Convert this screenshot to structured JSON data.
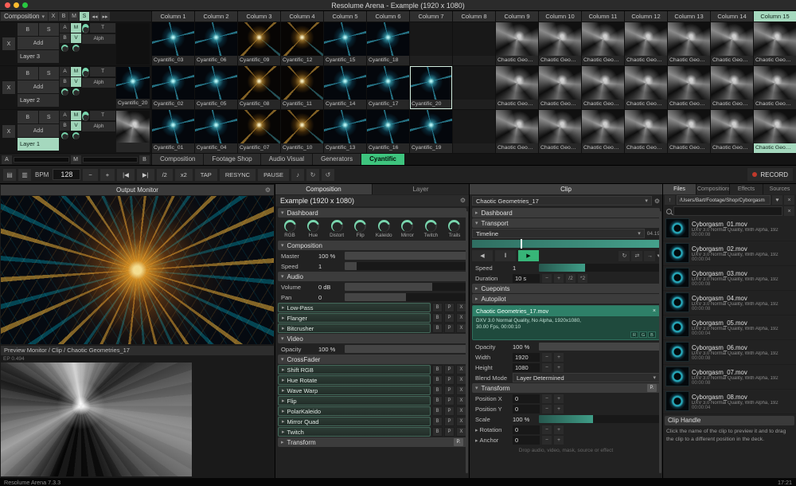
{
  "titlebar": {
    "title": "Resolume Arena - Example (1920 x 1080)"
  },
  "grid": {
    "composition_menu": "Composition",
    "comp_buttons": [
      "X",
      "B",
      "M",
      "S"
    ],
    "columns": [
      "Column 1",
      "Column 2",
      "Column 3",
      "Column 4",
      "Column 5",
      "Column 6",
      "Column 7",
      "Column 8",
      "Column 9",
      "Column 10",
      "Column 11",
      "Column 12",
      "Column 13",
      "Column 14",
      "Column 15"
    ],
    "active_column": "Column 15",
    "layers": [
      {
        "name": "Layer 3",
        "clear": "X",
        "bypass": "B",
        "solo": "S",
        "add": "Add",
        "ab": [
          "A",
          "B"
        ],
        "mv": [
          "M",
          "V"
        ],
        "t": "T",
        "alpha": "Alph",
        "preview": null,
        "clips": [
          {
            "label": "Cyantific_03",
            "variant": "teal"
          },
          {
            "label": "Cyantific_06",
            "variant": "teal"
          },
          {
            "label": "Cyantific_09",
            "variant": "gold"
          },
          {
            "label": "Cyantific_12",
            "variant": "gold"
          },
          {
            "label": "Cyantific_15",
            "variant": "teal"
          },
          {
            "label": "Cyantific_18",
            "variant": "teal"
          },
          {
            "label": "",
            "variant": "empty"
          },
          {
            "label": "",
            "variant": "empty"
          },
          {
            "label": "Chaotic Geometri...",
            "variant": "gray"
          },
          {
            "label": "Chaotic Geometri...",
            "variant": "gray"
          },
          {
            "label": "Chaotic Geometri...",
            "variant": "gray"
          },
          {
            "label": "Chaotic Geometri...",
            "variant": "gray"
          },
          {
            "label": "Chaotic Geometri...",
            "variant": "gray"
          },
          {
            "label": "Chaotic Geometri...",
            "variant": "gray"
          },
          {
            "label": "Chaotic Geometri...",
            "variant": "gray"
          }
        ]
      },
      {
        "name": "Layer 2",
        "clear": "X",
        "bypass": "B",
        "solo": "S",
        "add": "Add",
        "ab": [
          "A",
          "B"
        ],
        "mv": [
          "M",
          "V"
        ],
        "t": "T",
        "alpha": "Alph",
        "preview": {
          "label": "Cyantific_20",
          "variant": "teal"
        },
        "clips": [
          {
            "label": "Cyantific_02",
            "variant": "teal"
          },
          {
            "label": "Cyantific_05",
            "variant": "teal"
          },
          {
            "label": "Cyantific_08",
            "variant": "gold"
          },
          {
            "label": "Cyantific_11",
            "variant": "gold"
          },
          {
            "label": "Cyantific_14",
            "variant": "teal"
          },
          {
            "label": "Cyantific_17",
            "variant": "teal"
          },
          {
            "label": "Cyantific_20",
            "variant": "teal",
            "selected": true
          },
          {
            "label": "",
            "variant": "empty"
          },
          {
            "label": "Chaotic Geometri...",
            "variant": "gray"
          },
          {
            "label": "Chaotic Geometri...",
            "variant": "gray"
          },
          {
            "label": "Chaotic Geometri...",
            "variant": "gray"
          },
          {
            "label": "Chaotic Geometri...",
            "variant": "gray"
          },
          {
            "label": "Chaotic Geometri...",
            "variant": "gray"
          },
          {
            "label": "Chaotic Geometri...",
            "variant": "gray"
          },
          {
            "label": "Chaotic Geometri...",
            "variant": "gray"
          }
        ]
      },
      {
        "name": "Layer 1",
        "active": true,
        "clear": "X",
        "bypass": "B",
        "solo": "S",
        "add": "Add",
        "ab": [
          "A",
          "B"
        ],
        "mv": [
          "M",
          "V"
        ],
        "t": "T",
        "alpha": "Alph",
        "preview": {
          "label": "",
          "variant": "gray"
        },
        "clips": [
          {
            "label": "Cyantific_01",
            "variant": "teal"
          },
          {
            "label": "Cyantific_04",
            "variant": "teal"
          },
          {
            "label": "Cyantific_07",
            "variant": "gold"
          },
          {
            "label": "Cyantific_10",
            "variant": "gold"
          },
          {
            "label": "Cyantific_13",
            "variant": "teal"
          },
          {
            "label": "Cyantific_16",
            "variant": "teal"
          },
          {
            "label": "Cyantific_19",
            "variant": "teal"
          },
          {
            "label": "",
            "variant": "empty"
          },
          {
            "label": "Chaotic Geometri...",
            "variant": "gray"
          },
          {
            "label": "Chaotic Geometri...",
            "variant": "gray"
          },
          {
            "label": "Chaotic Geometri...",
            "variant": "gray"
          },
          {
            "label": "Chaotic Geometri...",
            "variant": "gray"
          },
          {
            "label": "Chaotic Geometri...",
            "variant": "gray"
          },
          {
            "label": "Chaotic Geometri...",
            "variant": "gray"
          },
          {
            "label": "Chaotic Geometri...",
            "variant": "gray",
            "playing": true
          }
        ]
      }
    ],
    "crossfader": {
      "a": "A",
      "m": "M",
      "b": "B"
    },
    "deck_tabs": [
      {
        "label": "Composition"
      },
      {
        "label": "Footage Shop"
      },
      {
        "label": "Audio Visual"
      },
      {
        "label": "Generators"
      },
      {
        "label": "Cyantific",
        "active": true
      }
    ]
  },
  "transport_bar": {
    "bpm_label": "BPM",
    "bpm_value": "128",
    "buttons": [
      "−",
      "+",
      "|◀",
      "▶|",
      "/2",
      "x2"
    ],
    "tap": "TAP",
    "resync": "RESYNC",
    "pause": "PAUSE",
    "record": "RECORD"
  },
  "monitors": {
    "output_title": "Output Monitor",
    "preview_label": "Preview Monitor / Clip / Chaotic Geometries_17",
    "preview_info": "EP 0.494"
  },
  "composition_panel": {
    "tabs": [
      {
        "label": "Composition",
        "active": true
      },
      {
        "label": "Layer"
      }
    ],
    "title": "Example (1920 x 1080)",
    "rows": [
      {
        "type": "section",
        "label": "Dashboard",
        "caret": "▾"
      },
      {
        "type": "knobs",
        "items": [
          "RGB",
          "Hue",
          "Distort",
          "Flip",
          "Kaleido",
          "Mirror",
          "Twitch",
          "Trails"
        ]
      },
      {
        "type": "section",
        "label": "Composition",
        "caret": "▾"
      },
      {
        "type": "slider",
        "label": "Master",
        "value": "100 %",
        "fill": 100,
        "color": "gray"
      },
      {
        "type": "slider",
        "label": "Speed",
        "value": "1",
        "fill": 10,
        "color": "gray"
      },
      {
        "type": "section",
        "label": "Audio",
        "caret": "▾"
      },
      {
        "type": "slider",
        "label": "Volume",
        "value": "0 dB",
        "fill": 72,
        "color": "gray"
      },
      {
        "type": "slider",
        "label": "Pan",
        "value": "0",
        "fill": 50,
        "color": "gray"
      },
      {
        "type": "effect",
        "label": "Low-Pass",
        "buttons": [
          "B",
          "P",
          "X"
        ]
      },
      {
        "type": "effect",
        "label": "Flanger",
        "buttons": [
          "B",
          "P",
          "X"
        ]
      },
      {
        "type": "effect",
        "label": "Bitcrusher",
        "buttons": [
          "B",
          "P",
          "X"
        ]
      },
      {
        "type": "section",
        "label": "Video",
        "caret": "▾"
      },
      {
        "type": "slider",
        "label": "Opacity",
        "value": "100 %",
        "fill": 100,
        "color": "gray"
      },
      {
        "type": "section",
        "label": "CrossFader",
        "caret": "▾"
      },
      {
        "type": "effect",
        "label": "Shift RGB",
        "buttons": [
          "B",
          "P",
          "X"
        ]
      },
      {
        "type": "effect",
        "label": "Hue Rotate",
        "buttons": [
          "B",
          "P",
          "X"
        ]
      },
      {
        "type": "effect",
        "label": "Wave Warp",
        "buttons": [
          "B",
          "P",
          "X"
        ]
      },
      {
        "type": "effect",
        "label": "Flip",
        "buttons": [
          "B",
          "P",
          "X"
        ]
      },
      {
        "type": "effect",
        "label": "PolarKaleido",
        "buttons": [
          "B",
          "P",
          "X"
        ]
      },
      {
        "type": "effect",
        "label": "Mirror Quad",
        "buttons": [
          "B",
          "P",
          "X"
        ]
      },
      {
        "type": "effect",
        "label": "Twitch",
        "buttons": [
          "B",
          "P",
          "X"
        ]
      },
      {
        "type": "section",
        "label": "Transform",
        "caret": "▸",
        "pbtn": "P."
      }
    ]
  },
  "clip_panel": {
    "tab": "Clip",
    "clip_select": "Chaotic Geometries_17",
    "transport_buttons": {
      "back": "◀",
      "pause": "‖",
      "play": "▶",
      "loop": "↻",
      "bounce": "⇄",
      "once": "→"
    },
    "rows": [
      {
        "type": "section",
        "label": "Dashboard",
        "caret": "▸"
      },
      {
        "type": "section",
        "label": "Transport",
        "caret": "▾"
      },
      {
        "type": "dropdown",
        "value": "Timeline",
        "time": "04.19"
      },
      {
        "type": "timeline",
        "fill": 100,
        "tick": 26
      },
      {
        "type": "transport"
      },
      {
        "type": "slider",
        "label": "Speed",
        "value": "1",
        "fill": 38,
        "color": "teal"
      },
      {
        "type": "stepper",
        "label": "Duration",
        "value": "10 s",
        "buttons": [
          "−",
          "+",
          "/2",
          "*2"
        ]
      },
      {
        "type": "section",
        "label": "Cuepoints",
        "caret": "▸"
      },
      {
        "type": "section",
        "label": "Autopilot",
        "caret": "▸"
      },
      {
        "type": "infobox",
        "title": "Chaotic Geometries_17.mov",
        "close": "×",
        "line1": "DXV 3.0 Normal Quality, No Alpha, 1920x1080,",
        "line2": "30.00 Fps, 00:00:10",
        "rgb": [
          "R",
          "G",
          "B"
        ]
      },
      {
        "type": "slider",
        "label": "Opacity",
        "value": "100 %",
        "fill": 100,
        "color": "gray"
      },
      {
        "type": "stepper",
        "label": "Width",
        "value": "1920",
        "buttons": [
          "−",
          "+"
        ]
      },
      {
        "type": "stepper",
        "label": "Height",
        "value": "1080",
        "buttons": [
          "−",
          "+"
        ]
      },
      {
        "type": "dropdown",
        "label": "Blend Mode",
        "value": "Layer Determined"
      },
      {
        "type": "section",
        "label": "Transform",
        "caret": "▾",
        "pbtn": "P."
      },
      {
        "type": "stepper",
        "label": "Position X",
        "value": "0",
        "buttons": [
          "−",
          "+"
        ]
      },
      {
        "type": "stepper",
        "label": "Position Y",
        "value": "0",
        "buttons": [
          "−",
          "+"
        ]
      },
      {
        "type": "slider",
        "label": "Scale",
        "value": "100 %",
        "fill": 45,
        "color": "teal"
      },
      {
        "type": "stepper",
        "label": "Rotation",
        "value": "0",
        "buttons": [
          "−",
          "+"
        ],
        "caret": "▸"
      },
      {
        "type": "stepper",
        "label": "Anchor",
        "value": "0",
        "buttons": [
          "−",
          "+"
        ],
        "caret": "▸"
      },
      {
        "type": "hint",
        "text": "Drop audio, video, mask, source or effect"
      }
    ]
  },
  "browser": {
    "tabs": [
      {
        "label": "Files",
        "active": true
      },
      {
        "label": "Compositions"
      },
      {
        "label": "Effects"
      },
      {
        "label": "Sources"
      }
    ],
    "path": "/Users/Bart/Footage/Shop/Cyborgasm",
    "files": [
      {
        "name": "Cyborgasm_01.mov",
        "meta": "DXV 3.0 Normal Quality, With Alpha, 192",
        "duration": "00:00:08"
      },
      {
        "name": "Cyborgasm_02.mov",
        "meta": "DXV 3.0 Normal Quality, With Alpha, 192",
        "duration": "00:00:04"
      },
      {
        "name": "Cyborgasm_03.mov",
        "meta": "DXV 3.0 Normal Quality, With Alpha, 192",
        "duration": "00:00:08"
      },
      {
        "name": "Cyborgasm_04.mov",
        "meta": "DXV 3.0 Normal Quality, With Alpha, 192",
        "duration": "00:00:08"
      },
      {
        "name": "Cyborgasm_05.mov",
        "meta": "DXV 3.0 Normal Quality, With Alpha, 192",
        "duration": "00:00:04"
      },
      {
        "name": "Cyborgasm_06.mov",
        "meta": "DXV 3.0 Normal Quality, With Alpha, 192",
        "duration": "00:00:08"
      },
      {
        "name": "Cyborgasm_07.mov",
        "meta": "DXV 3.0 Normal Quality, With Alpha, 192",
        "duration": "00:00:08"
      },
      {
        "name": "Cyborgasm_08.mov",
        "meta": "DXV 3.0 Normal Quality, With Alpha, 192",
        "duration": "00:00:04"
      }
    ],
    "clip_handle_title": "Clip Handle",
    "clip_handle_text": "Click the name of the clip to preview it and to drag the clip to a different position in the deck."
  },
  "statusbar": {
    "left": "Resolume Arena 7.3.3",
    "right": "17:21"
  }
}
